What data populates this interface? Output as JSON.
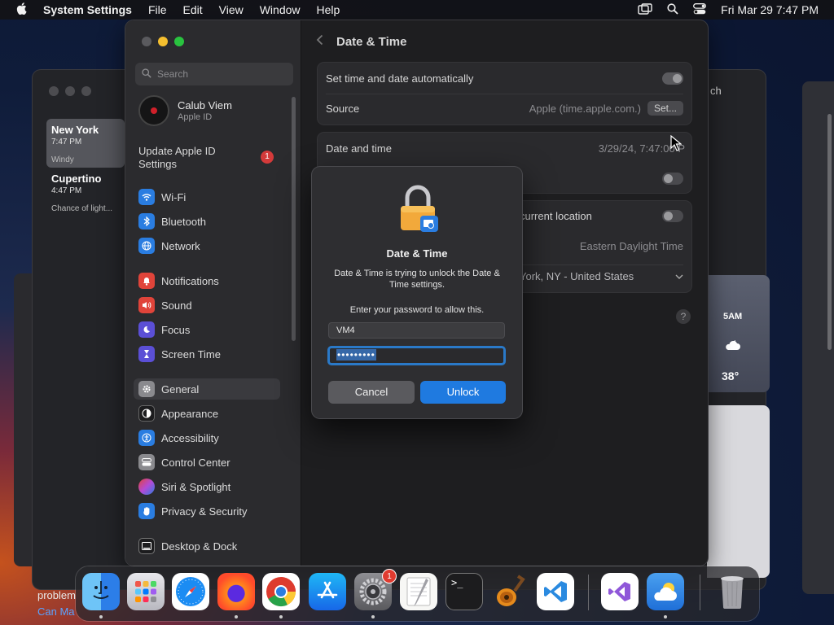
{
  "menubar": {
    "app_name": "System Settings",
    "menus": [
      "File",
      "Edit",
      "View",
      "Window",
      "Help"
    ],
    "clock": "Fri Mar 29  7:47 PM"
  },
  "weather": {
    "cities": [
      {
        "name": "New York",
        "time": "7:47 PM",
        "condition": "Windy"
      },
      {
        "name": "Cupertino",
        "time": "4:47 PM",
        "condition": "Chance of light..."
      }
    ],
    "search_tail": "ch",
    "hourly": {
      "hour": "5AM",
      "temp": "38°"
    }
  },
  "background_text": {
    "line1": "problem",
    "link": "Can Ma"
  },
  "settings": {
    "search_placeholder": "Search",
    "account": {
      "name": "Calub Viem",
      "subtitle": "Apple ID"
    },
    "update": {
      "label": "Update Apple ID Settings",
      "badge": "1"
    },
    "sidebar_items": [
      {
        "label": "Wi-Fi",
        "color": "#2a7de1"
      },
      {
        "label": "Bluetooth",
        "color": "#2a7de1"
      },
      {
        "label": "Network",
        "color": "#2a7de1"
      },
      {
        "label": "Notifications",
        "color": "#e0443a"
      },
      {
        "label": "Sound",
        "color": "#e0443a"
      },
      {
        "label": "Focus",
        "color": "#5b4fd6"
      },
      {
        "label": "Screen Time",
        "color": "#5b4fd6"
      },
      {
        "label": "General",
        "color": "#8a8a8e"
      },
      {
        "label": "Appearance",
        "color": "#1c1c1e"
      },
      {
        "label": "Accessibility",
        "color": "#2a7de1"
      },
      {
        "label": "Control Center",
        "color": "#8a8a8e"
      },
      {
        "label": "Siri & Spotlight",
        "color": "#b44ad6"
      },
      {
        "label": "Privacy & Security",
        "color": "#2a7de1"
      },
      {
        "label": "Desktop & Dock",
        "color": "#1c1c1e"
      }
    ],
    "page_title": "Date & Time",
    "rows": {
      "auto_set": "Set time and date automatically",
      "source_label": "Source",
      "source_value": "Apple (time.apple.com.)",
      "set_button": "Set...",
      "date_time_label": "Date and time",
      "date_time_value": "3/29/24, 7:47:00 P",
      "location_label": "current location",
      "timezone_value": "Eastern Daylight Time",
      "city_value": "York, NY - United States",
      "help": "?"
    }
  },
  "dialog": {
    "title": "Date & Time",
    "message": "Date & Time is trying to unlock the Date & Time settings.",
    "prompt": "Enter your password to allow this.",
    "username": "VM4",
    "password_mask": "•••••••••",
    "cancel_label": "Cancel",
    "unlock_label": "Unlock"
  },
  "dock": {
    "settings_badge": "1",
    "terminal_glyph": ">_"
  }
}
